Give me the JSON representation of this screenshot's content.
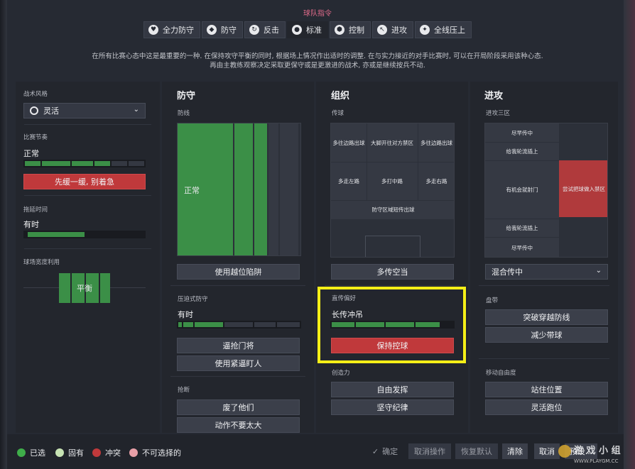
{
  "header": {
    "title": "球队指令",
    "tabs": [
      {
        "label": "全力防守",
        "icon": "shield-heart-icon"
      },
      {
        "label": "防守",
        "icon": "shield-icon"
      },
      {
        "label": "反击",
        "icon": "counter-icon"
      },
      {
        "label": "标准",
        "icon": "standard-icon",
        "active": true
      },
      {
        "label": "控制",
        "icon": "ball-icon"
      },
      {
        "label": "进攻",
        "icon": "attack-arrow-icon"
      },
      {
        "label": "全线压上",
        "icon": "overload-icon"
      }
    ],
    "description_line1": "在所有比赛心态中这是最重要的一种. 在保持攻守平衡的同时, 根据场上情况作出适时的调整. 在与实力接近的对手比赛时, 可以在开局阶段采用该种心态.",
    "description_line2": "再由主教练观察决定采取更保守或是更激进的战术, 亦或是继续按兵不动."
  },
  "sidebar": {
    "style_label": "战术风格",
    "style_value": "灵活",
    "tempo_label": "比赛节奏",
    "tempo_value": "正常",
    "tempo_level": 0.5,
    "tempo_button": "先缓一缓, 别着急",
    "timewasting_label": "拖延时间",
    "timewasting_value": "有时",
    "timewasting_level": 0.45,
    "width_label": "球场宽度利用",
    "width_value": "平衡"
  },
  "defence": {
    "title": "防守",
    "line_label": "防线",
    "line_value": "正常",
    "offside_button": "使用越位陷阱",
    "press_label": "压迫式防守",
    "press_value": "有时",
    "press_level": 0.4,
    "btn_close_down": "逼抢门将",
    "btn_tight_marking": "使用紧逼盯人",
    "tackling_label": "抢断",
    "btn_get_stuck_in": "废了他们",
    "btn_stay_on_feet": "动作不要太大"
  },
  "organisation": {
    "title": "组织",
    "passing_label": "传球",
    "passing_cells": [
      "多往边路出球",
      "大脚开往对方禁区",
      "多往边路出球",
      "多走左路",
      "多打中路",
      "多走右路",
      "防守区域短传出球"
    ],
    "btn_more_passing": "多传空当",
    "crossing_label": "直传偏好",
    "crossing_value": "长传冲吊",
    "crossing_level": 0.8,
    "btn_keep_ball": "保持控球",
    "creativity_label": "创造力",
    "btn_free_role": "自由发挥",
    "btn_discipline": "坚守纪律"
  },
  "attack": {
    "title": "进攻",
    "final_third_label": "进攻三区",
    "final_third_cells": [
      "尽早传中",
      "给我轮流插上",
      "有机会就射门",
      "尝试把球做入禁区",
      "给我轮流插上",
      "尽早传中"
    ],
    "cross_select": "混合传中",
    "dribbling_label": "盘带",
    "btn_run_at_defence": "突破穿越防线",
    "btn_dribble_less": "减少带球",
    "movement_label": "移动自由度",
    "btn_hold_position": "站住位置",
    "btn_roam": "灵活跑位"
  },
  "footer": {
    "legend": [
      {
        "label": "已选",
        "color": "#3fae4a"
      },
      {
        "label": "固有",
        "color": "#c7e3b4"
      },
      {
        "label": "冲突",
        "color": "#c0393b"
      },
      {
        "label": "不可选择的",
        "color": "#e8a0a8"
      }
    ],
    "confirm": "确定",
    "undo": "取消操作",
    "reset": "恢复默认",
    "clear": "清除",
    "cancel": "取消",
    "preset": "预设...",
    "watermark": "游 戏 小 组",
    "watermark_url": "WWW.PLAYGM.CC"
  }
}
